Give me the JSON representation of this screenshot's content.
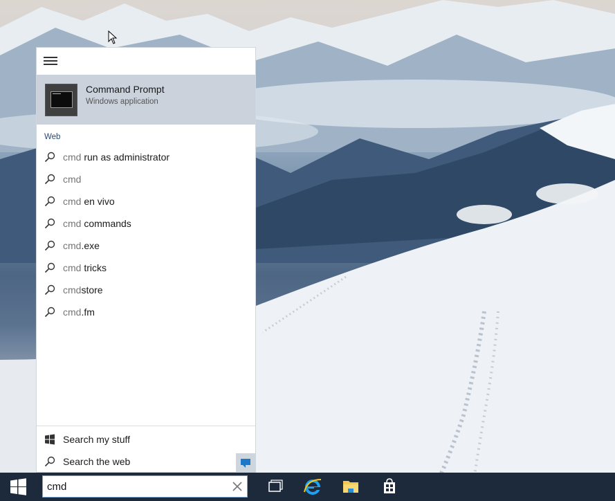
{
  "start_menu": {
    "best_match": {
      "title": "Command Prompt",
      "subtitle": "Windows application"
    },
    "web_section_label": "Web",
    "web_results": [
      {
        "query": "cmd",
        "suffix": " run as administrator"
      },
      {
        "query": "cmd",
        "suffix": ""
      },
      {
        "query": "cmd",
        "suffix": " en vivo"
      },
      {
        "query": "cmd",
        "suffix": " commands"
      },
      {
        "query": "cmd",
        "suffix": ".exe"
      },
      {
        "query": "cmd",
        "suffix": " tricks"
      },
      {
        "query": "cmd",
        "suffix": "store"
      },
      {
        "query": "cmd",
        "suffix": ".fm"
      }
    ],
    "search_my_stuff": "Search my stuff",
    "search_the_web": "Search the web"
  },
  "taskbar": {
    "search_value": "cmd",
    "icons": [
      "task-view-icon",
      "internet-explorer-icon",
      "file-explorer-icon",
      "store-icon"
    ]
  },
  "colors": {
    "taskbar": "#1d2a3c",
    "selection": "#cbd2dc",
    "accent": "#1e78c8"
  }
}
